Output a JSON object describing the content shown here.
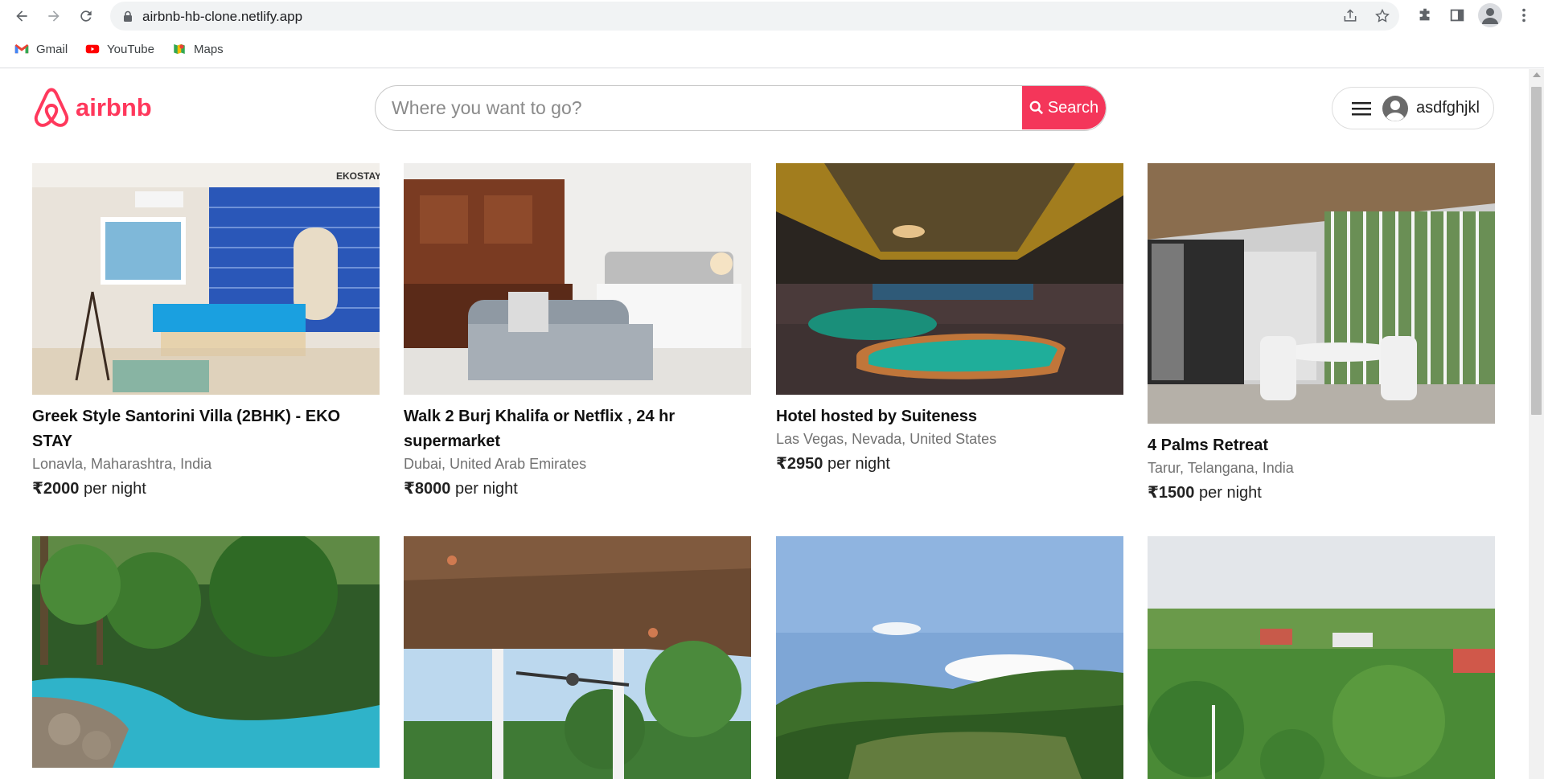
{
  "browser": {
    "url": "airbnb-hb-clone.netlify.app",
    "bookmarks": [
      {
        "label": "Gmail",
        "icon": "gmail-icon"
      },
      {
        "label": "YouTube",
        "icon": "youtube-icon"
      },
      {
        "label": "Maps",
        "icon": "maps-icon"
      }
    ]
  },
  "header": {
    "logo_text": "airbnb",
    "search_placeholder": "Where you want to go?",
    "search_button": "Search",
    "username": "asdfghjkl"
  },
  "colors": {
    "brand": "#FF385C",
    "search_button": "#F4365A"
  },
  "listings": [
    {
      "title": "Greek Style Santorini Villa (2BHK) - EKO STAY",
      "location": "Lonavla, Maharashtra, India",
      "price": "₹2000",
      "unit": "per night",
      "image": "blue bedroom with tiled wall",
      "badge": "EKOSTAY"
    },
    {
      "title": "Walk 2 Burj Khalifa or Netflix , 24 hr supermarket",
      "location": "Dubai, United Arab Emirates",
      "price": "₹8000",
      "unit": "per night",
      "image": "apartment with kitchen and bed"
    },
    {
      "title": "Hotel hosted by Suiteness",
      "location": "Las Vegas, Nevada, United States",
      "price": "₹2950",
      "unit": "per night",
      "image": "casino floor with gaming tables"
    },
    {
      "title": "4 Palms Retreat",
      "location": "Tarur, Telangana, India",
      "price": "₹1500",
      "unit": "per night",
      "image": "patio with white wicker chairs"
    },
    {
      "title": "",
      "location": "",
      "price": "",
      "unit": "",
      "image": "swimming pool surrounded by palms"
    },
    {
      "title": "",
      "location": "",
      "price": "",
      "unit": "",
      "image": "covered veranda overlooking trees"
    },
    {
      "title": "",
      "location": "",
      "price": "",
      "unit": "",
      "image": "green valley and blue sky"
    },
    {
      "title": "",
      "location": "",
      "price": "",
      "unit": "",
      "image": "aerial view of resort with gardens"
    }
  ]
}
